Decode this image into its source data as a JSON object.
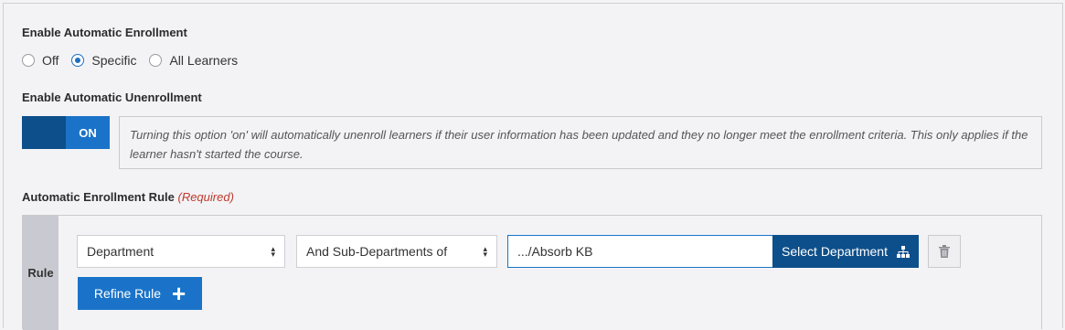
{
  "enrollment": {
    "title": "Enable Automatic Enrollment",
    "options": [
      {
        "label": "Off",
        "checked": false
      },
      {
        "label": "Specific",
        "checked": true
      },
      {
        "label": "All Learners",
        "checked": false
      }
    ]
  },
  "unenrollment": {
    "title": "Enable Automatic Unenrollment",
    "toggle_label": "ON",
    "info": "Turning this option 'on' will automatically unenroll learners if their user information has been updated and they no longer meet the enrollment criteria. This only applies if the learner hasn't started the course."
  },
  "rule_section": {
    "title": "Automatic Enrollment Rule",
    "required": "(Required)",
    "rule_label": "Rule",
    "field_select": "Department",
    "operator_select": "And Sub-Departments of",
    "department_value": ".../Absorb KB",
    "select_department_label": "Select Department",
    "refine_label": "Refine Rule"
  },
  "colors": {
    "primary": "#1a73c8",
    "primary_dark": "#0d4f8a",
    "required": "#c0392b"
  },
  "icons": {
    "select_department": "sitemap-icon",
    "delete": "trash-icon",
    "refine": "plus-icon"
  }
}
